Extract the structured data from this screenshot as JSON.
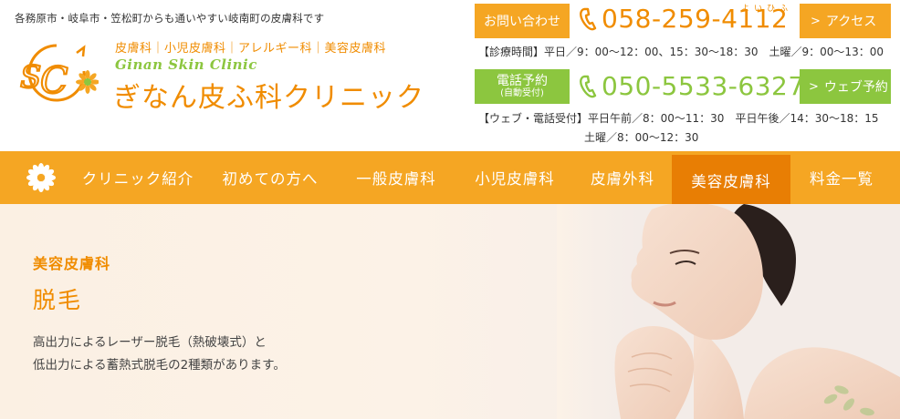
{
  "header": {
    "tagline": "各務原市・岐阜市・笠松町からも通いやすい岐南町の皮膚科です",
    "sub_categories": "皮膚科｜小児皮膚科｜アレルギー科｜美容皮膚科",
    "clinic_name_en": "Ginan Skin Clinic",
    "clinic_name_jp": "ぎなん皮ふ科クリニック",
    "logo_text": "GSC",
    "contact_button": "お問い合わせ",
    "phone_main": "058-259-4112",
    "phone_ruby": "よいひふ",
    "access_button": "アクセス",
    "hours_line": "【診療時間】平日／9：00～12：00、15：30～18：30　土曜／9：00～13：00",
    "reserve_button_main": "電話予約",
    "reserve_button_sub": "(自動受付)",
    "phone_reserve": "050-5533-6327",
    "web_reserve_button": "ウェブ予約",
    "reserve_hours_line1": "【ウェブ・電話受付】平日午前／8：00～11：30　平日午後／14：30～18：15",
    "reserve_hours_line2": "土曜／8：00～12：30"
  },
  "nav": {
    "items": [
      {
        "label": "クリニック紹介",
        "active": false
      },
      {
        "label": "初めての方へ",
        "active": false
      },
      {
        "label": "一般皮膚科",
        "active": false
      },
      {
        "label": "小児皮膚科",
        "active": false
      },
      {
        "label": "皮膚外科",
        "active": false
      },
      {
        "label": "美容皮膚科",
        "active": true
      },
      {
        "label": "料金一覧",
        "active": false
      }
    ]
  },
  "hero": {
    "category": "美容皮膚科",
    "title": "脱毛",
    "description_line1": "高出力によるレーザー脱毛（熱破壊式）と",
    "description_line2": "低出力による蓄熱式脱毛の2種類があります。"
  },
  "colors": {
    "orange": "#f5a623",
    "orange_text": "#f08c00",
    "orange_active": "#e87e04",
    "green": "#8cc63f"
  },
  "icons": {
    "phone": "phone-handset-icon",
    "nav_logo": "flower-icon",
    "chevron": "chevron-right-icon"
  }
}
